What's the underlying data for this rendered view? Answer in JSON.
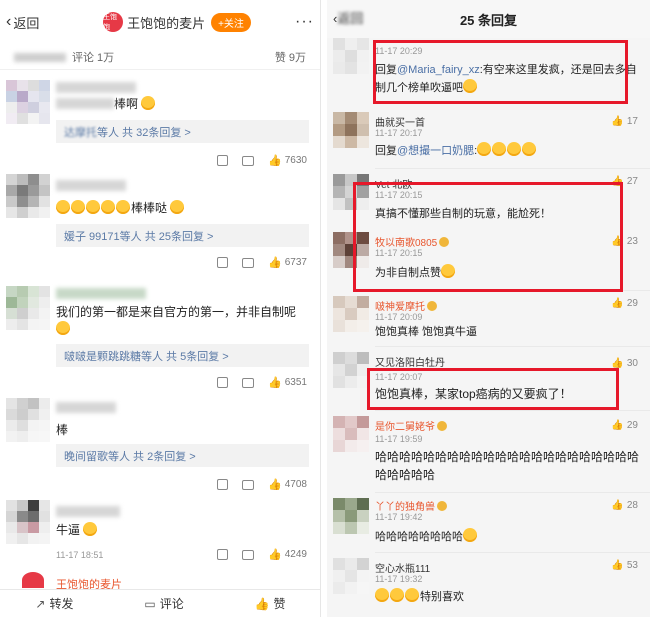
{
  "left": {
    "back_label": "返回",
    "account_name": "王饱饱的麦片",
    "avatar_text": "王饱饱",
    "follow_label": "+关注",
    "more_icon": "···",
    "comments_count": "评论 1万",
    "likes_count": "赞 9万",
    "comments": [
      {
        "text": "棒啊",
        "reply": "等人  共 32条回复 >",
        "reply_who": "达摩托",
        "likes": "7630"
      },
      {
        "text": "棒棒哒",
        "reply": "等人  共 25条回复 >",
        "reply_who": "媛子 99171",
        "likes": "6737"
      },
      {
        "text": "我们的第一都是来自官方的第一，并非自制呢",
        "reply": "等人  共 5条回复 >",
        "reply_who": "啵啵是颗跳跳糖",
        "likes": "6351"
      },
      {
        "text": "棒",
        "reply": "等人  共 2条回复 >",
        "reply_who": "晚间留歌",
        "likes": "4708"
      },
      {
        "text": "牛逼",
        "time": "11-17  18:51",
        "likes": "4249"
      }
    ],
    "last_name": "王饱饱的麦片",
    "bottom": {
      "repost": "转发",
      "comment": "评论",
      "like": "赞"
    }
  },
  "right": {
    "back_label": "返回",
    "title": "25 条回复",
    "replies": [
      {
        "time": "11-17  20:29",
        "text_pre": "回复",
        "mention": "@Maria_fairy_xz",
        "text": ":有空来这里发疯，还是回去多自制几个榜单吹逼吧",
        "likes": ""
      },
      {
        "name": "曲就买一首",
        "time": "11-17  20:17",
        "text_pre": "回复",
        "mention": "@想撮一口奶腮",
        "text": ":",
        "likes": "17"
      },
      {
        "name": "Vet 北欧",
        "time": "11-17  20:15",
        "text": "真搞不懂那些自制的玩意，能尬死！",
        "likes": "27"
      },
      {
        "name": "牧以南歌0805",
        "time": "11-17  20:15",
        "text": "为非自制点赞",
        "likes": "23"
      },
      {
        "name": "啵神爱摩托",
        "time": "11-17  20:09",
        "text": "饱饱真棒  饱饱真牛逼",
        "likes": "29"
      },
      {
        "name": "又见洛阳白牡丹",
        "time": "11-17  20:07",
        "text": "饱饱真棒，某家top癌病的又要疯了！",
        "likes": "30"
      },
      {
        "name": "是你二舅姥爷",
        "time": "11-17  19:59",
        "text": "哈哈哈哈哈哈哈哈哈哈哈哈哈哈哈哈哈哈哈哈哈哈哈哈哈哈哈",
        "likes": "29"
      },
      {
        "name": "丫丫的独角兽",
        "time": "11-17  19:42",
        "text": "哈哈哈哈哈哈哈哈",
        "likes": "28"
      },
      {
        "name": "空心水瓶111",
        "time": "11-17  19:32",
        "text": "特别喜欢",
        "likes": "53"
      }
    ]
  },
  "colors": {
    "accent_orange": "#ff8200",
    "highlight_red": "#e6182a",
    "link_blue": "#4a6fa5",
    "name_orange": "#e8572f"
  }
}
